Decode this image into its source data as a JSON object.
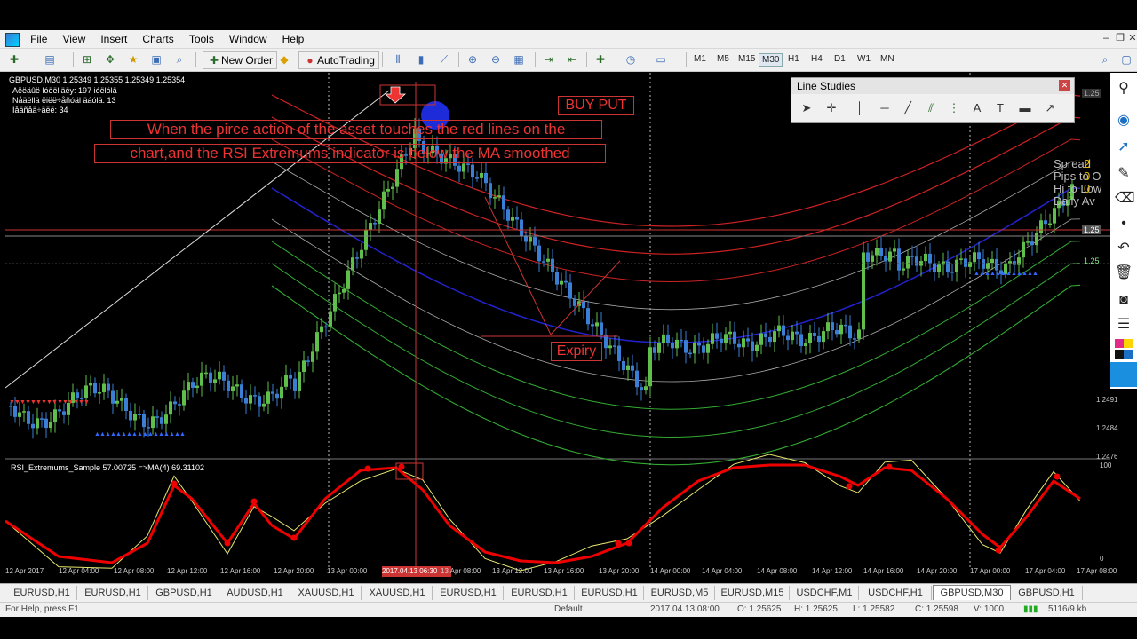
{
  "menu": [
    "File",
    "View",
    "Insert",
    "Charts",
    "Tools",
    "Window",
    "Help"
  ],
  "toolbar": {
    "new_order": "New Order",
    "autotrading": "AutoTrading",
    "timeframes": [
      "M1",
      "M5",
      "M15",
      "M30",
      "H1",
      "H4",
      "D1",
      "W1",
      "MN"
    ],
    "active_timeframe": "M30"
  },
  "chart": {
    "header": "GBPUSD,M30  1.25349 1.25355 1.25349 1.25354",
    "info_lines": [
      "Aëëäûë lóëëlläëy: 197 ióëlólä",
      "Nåäëllä ëiëë÷åñóäl äáólä: 13",
      "Ïåäñåä÷äëë: 34"
    ],
    "annotation_main_1": "When the pirce action of the asset touches the red lines on the",
    "annotation_main_2": "chart,and the RSI Extremums indicator is below the MA smoothed",
    "annotation_buy": "BUY PUT",
    "annotation_expiry": "Expiry",
    "side_info": [
      "Spread",
      "Pips to O",
      "Hi to Low",
      "Daily Av"
    ],
    "side_values": [
      "2",
      "0",
      "0"
    ],
    "price_axis": [
      "1.25",
      "1.25",
      "1.25",
      "1.2491",
      "1.2484",
      "1.2476"
    ],
    "indicator_label": "RSI_Extremums_Sample 57.00725  =>MA(4) 69.31102",
    "indicator_axis": [
      "100",
      "0"
    ],
    "time_axis": [
      "12 Apr 2017",
      "12 Apr 04:00",
      "12 Apr 08:00",
      "12 Apr 12:00",
      "12 Apr 16:00",
      "12 Apr 20:00",
      "13 Apr 00:00",
      "2017.04.13 06:30",
      "13 Apr 08:00",
      "13 Apr 12:00",
      "13 Apr 16:00",
      "13 Apr 20:00",
      "14 Apr 00:00",
      "14 Apr 04:00",
      "14 Apr 08:00",
      "14 Apr 12:00",
      "14 Apr 16:00",
      "14 Apr 20:00",
      "17 Apr 00:00",
      "17 Apr 04:00",
      "17 Apr 08:00"
    ]
  },
  "line_studies": {
    "title": "Line Studies"
  },
  "tabs": [
    "EURUSD,H1",
    "EURUSD,H1",
    "GBPUSD,H1",
    "AUDUSD,H1",
    "XAUUSD,H1",
    "XAUUSD,H1",
    "EURUSD,H1",
    "EURUSD,H1",
    "EURUSD,H1",
    "EURUSD,M5",
    "EURUSD,M15",
    "USDCHF,M1",
    "USDCHF,H1",
    "GBPUSD,M30",
    "GBPUSD,H1"
  ],
  "active_tab": "GBPUSD,M30",
  "status": {
    "help": "For Help, press F1",
    "profile": "Default",
    "datetime": "2017.04.13 08:00",
    "open": "O: 1.25625",
    "high": "H: 1.25625",
    "low": "L: 1.25582",
    "close": "C: 1.25598",
    "volume": "V: 1000",
    "traffic": "5116/9 kb"
  }
}
